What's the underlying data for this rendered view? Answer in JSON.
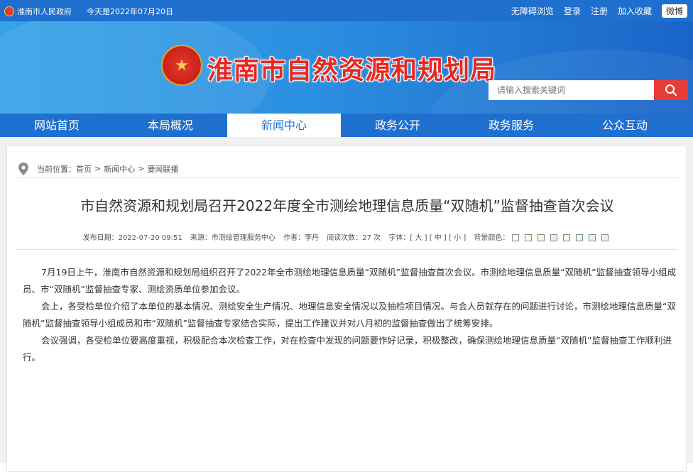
{
  "topbar": {
    "gov_link": "淮南市人民政府",
    "date_text": "今天是2022年07月20日",
    "links": [
      "无障碍浏览",
      "登录",
      "注册",
      "加入收藏"
    ],
    "weibo": "微博"
  },
  "header": {
    "site_title": "淮南市自然资源和规划局",
    "search_placeholder": "请输入搜索关键词"
  },
  "nav": {
    "items": [
      "网站首页",
      "本局概况",
      "新闻中心",
      "政务公开",
      "政务服务",
      "公众互动"
    ],
    "active_index": 2
  },
  "breadcrumb": {
    "prefix": "当前位置：",
    "items": [
      "首页",
      "新闻中心",
      "要闻联播"
    ],
    "sep": ">"
  },
  "article": {
    "title": "市自然资源和规划局召开2022年度全市测绘地理信息质量“双随机”监督抽查首次会议",
    "meta": {
      "publish": "发布日期：2022-07-20 09:51",
      "source": "来源：市测绘管理服务中心",
      "author": "作者：李丹",
      "views": "阅读次数：27 次",
      "font_label": "字体：",
      "font_large": "大",
      "font_medium": "中",
      "font_small": "小",
      "bg_label": "背景颜色："
    },
    "bg_colors": [
      "#ffffff",
      "#fafbe6",
      "#fff2e2",
      "#fde6e0",
      "#f3ffe1",
      "#dafaff",
      "#ebeaff",
      "#eeeeee"
    ],
    "paragraphs": [
      "7月19日上午，淮南市自然资源和规划局组织召开了2022年全市测绘地理信息质量“双随机”监督抽查首次会议。市测绘地理信息质量“双随机”监督抽查领导小组成员、市“双随机”监督抽查专家、测绘资质单位参加会议。",
      "会上，各受检单位介绍了本单位的基本情况、测绘安全生产情况、地理信息安全情况以及抽检项目情况。与会人员就存在的问题进行讨论，市测绘地理信息质量“双随机”监督抽查领导小组成员和市“双随机”监督抽查专家结合实际，提出工作建议并对八月初的监督抽查做出了统筹安排。",
      "会议强调，各受检单位要高度重视，积极配合本次检查工作，对在检查中发现的问题要作好记录，积极整改，确保测绘地理信息质量“双随机”监督抽查工作顺利进行。"
    ]
  }
}
